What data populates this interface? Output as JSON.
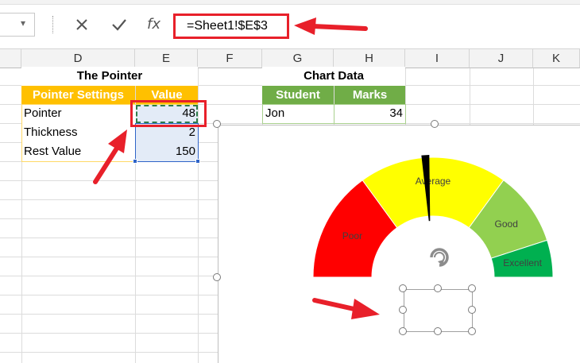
{
  "formula_bar": {
    "name_box_arrow": "▾",
    "cancel_icon": "x-icon",
    "enter_icon": "check-icon",
    "fx_label": "fx",
    "formula": "=Sheet1!$E$3"
  },
  "columns": [
    "D",
    "E",
    "F",
    "G",
    "H",
    "I",
    "J",
    "K"
  ],
  "pointer_table": {
    "title": "The Pointer",
    "header_settings": "Pointer Settings",
    "header_value": "Value",
    "rows": [
      {
        "label": "Pointer",
        "value": "48"
      },
      {
        "label": "Thickness",
        "value": "2"
      },
      {
        "label": "Rest Value",
        "value": "150"
      }
    ]
  },
  "chart_table": {
    "title": "Chart Data",
    "header_student": "Student",
    "header_marks": "Marks",
    "rows": [
      {
        "student": "Jon",
        "marks": "34"
      }
    ]
  },
  "chart_data": {
    "type": "pie",
    "subtype": "gauge-half-doughnut",
    "categories": [
      "Poor",
      "Average",
      "Good",
      "Excellent"
    ],
    "values": [
      30,
      40,
      20,
      10
    ],
    "colors": [
      "#ff0000",
      "#ffff00",
      "#92d050",
      "#00b050"
    ],
    "pointer_value": 48,
    "pointer_color": "#000000"
  },
  "colors": {
    "header_orange": "#ffc000",
    "header_green": "#70ad47",
    "annotation_red": "#e8202a",
    "selection_blue": "#2f64c8"
  }
}
